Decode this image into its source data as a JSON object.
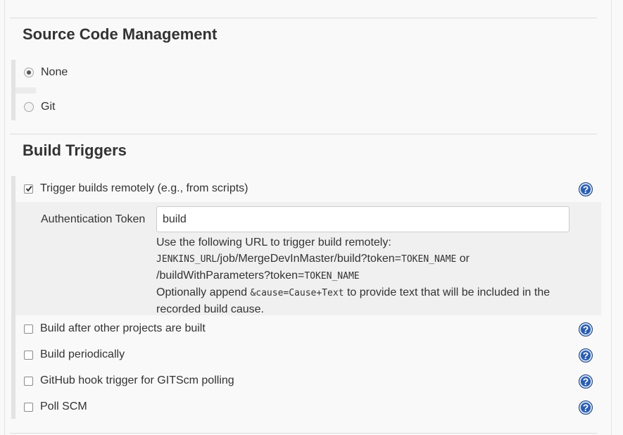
{
  "scm": {
    "title": "Source Code Management",
    "options": [
      {
        "label": "None",
        "selected": true
      },
      {
        "label": "Git",
        "selected": false
      }
    ]
  },
  "triggers": {
    "title": "Build Triggers",
    "remote": {
      "label": "Trigger builds remotely (e.g., from scripts)",
      "checked": true,
      "auth_label": "Authentication Token",
      "auth_value": "build",
      "help": {
        "line1": "Use the following URL to trigger build remotely:",
        "line2_code_a": "JENKINS_URL",
        "line2_text_a": "/job/MergeDevInMaster/build?token=",
        "line2_code_b": "TOKEN_NAME",
        "line2_text_b": " or",
        "line3_text": "/buildWithParameters?token=",
        "line3_code": "TOKEN_NAME",
        "line4_text_a": "Optionally append ",
        "line4_code": "&cause=Cause+Text",
        "line4_text_b": " to provide text that will be included in the",
        "line5": "recorded build cause."
      }
    },
    "others": [
      {
        "label": "Build after other projects are built",
        "checked": false
      },
      {
        "label": "Build periodically",
        "checked": false
      },
      {
        "label": "GitHub hook trigger for GITScm polling",
        "checked": false
      },
      {
        "label": "Poll SCM",
        "checked": false
      }
    ],
    "help_icon": "?"
  },
  "colors": {
    "background": "#f9f9f9",
    "help_icon": "#2a5db0",
    "text": "#333333"
  },
  "icons": {
    "help": "help-icon",
    "checkmark": "checkmark-icon"
  }
}
